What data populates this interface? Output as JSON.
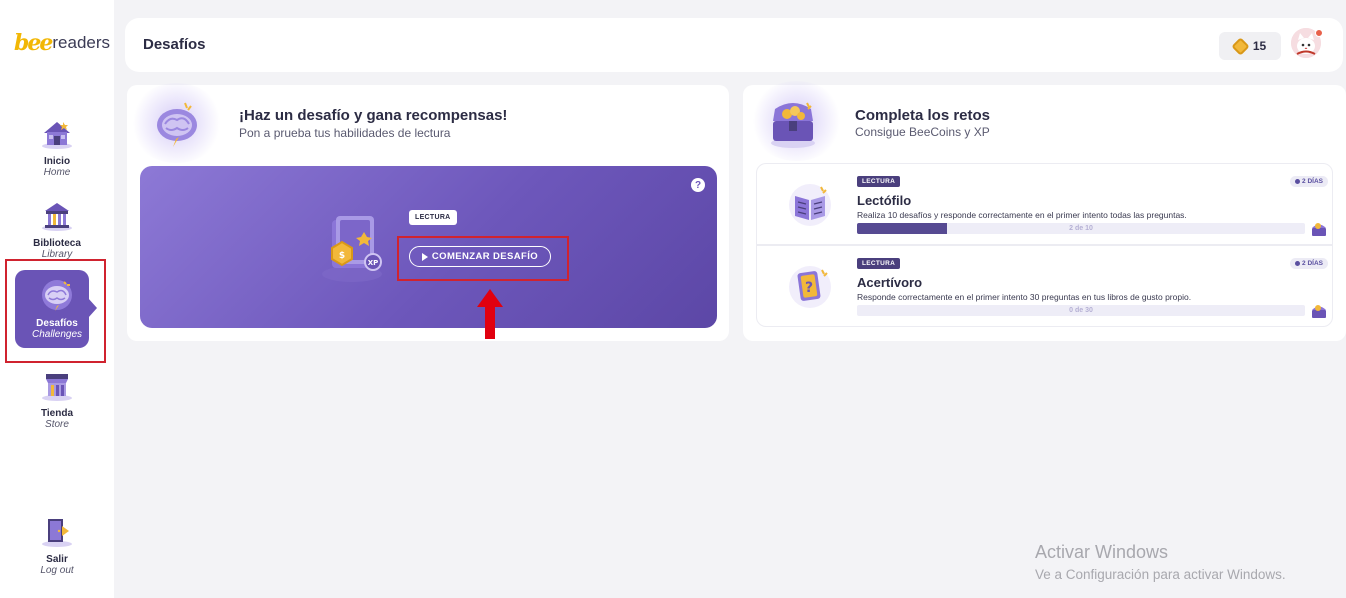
{
  "brand": {
    "logo_bee": "bee",
    "logo_readers": "readers"
  },
  "sidebar": {
    "items": [
      {
        "label": "Inicio",
        "sub": "Home",
        "icon": "house-icon",
        "active": false
      },
      {
        "label": "Biblioteca",
        "sub": "Library",
        "icon": "library-icon",
        "active": false
      },
      {
        "label": "Desafíos",
        "sub": "Challenges",
        "icon": "brain-icon",
        "active": true
      },
      {
        "label": "Tienda",
        "sub": "Store",
        "icon": "store-icon",
        "active": false
      },
      {
        "label": "Salir",
        "sub": "Log out",
        "icon": "logout-door-icon",
        "active": false
      }
    ]
  },
  "header": {
    "title": "Desafíos",
    "coins": "15",
    "coin_icon": "beecoin-icon",
    "avatar_icon": "cat-avatar-icon"
  },
  "challenge": {
    "title": "¡Haz un desafío y gana recompensas!",
    "subtitle": "Pon a prueba tus habilidades de lectura",
    "tag": "LECTURA",
    "button": "COMENZAR DESAFÍO",
    "help": "?"
  },
  "quests": {
    "title": "Completa los retos",
    "subtitle": "Consigue BeeCoins y XP",
    "items": [
      {
        "tag": "LECTURA",
        "days": "2 DÍAS",
        "title": "Lectófilo",
        "description": "Realiza 10 desafíos y responde correctamente en el primer intento todas las preguntas.",
        "progress_text": "2 de 10",
        "progress": 0.2
      },
      {
        "tag": "LECTURA",
        "days": "2 DÍAS",
        "title": "Acertívoro",
        "description": "Responde correctamente en el primer intento 30 preguntas en tus libros de gusto propio.",
        "progress_text": "0 de 30",
        "progress": 0
      }
    ]
  },
  "watermark": {
    "title": "Activar Windows",
    "subtitle": "Ve a Configuración para activar Windows."
  },
  "colors": {
    "accent": "#6a54b6",
    "highlight": "#d0232f",
    "coin": "#f2b83a"
  }
}
